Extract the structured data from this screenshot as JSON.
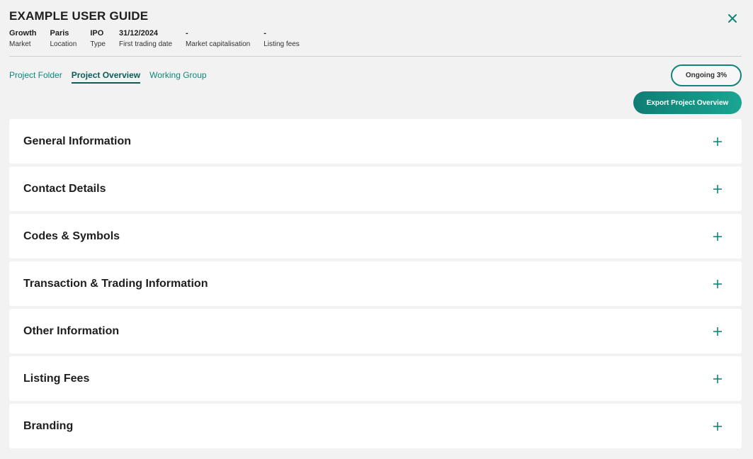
{
  "header": {
    "title": "EXAMPLE USER GUIDE",
    "close_icon": "close-icon"
  },
  "meta": [
    {
      "value": "Growth",
      "label": "Market"
    },
    {
      "value": "Paris",
      "label": "Location"
    },
    {
      "value": "IPO",
      "label": "Type"
    },
    {
      "value": "31/12/2024",
      "label": "First trading date"
    },
    {
      "value": "-",
      "label": "Market capitalisation"
    },
    {
      "value": "-",
      "label": "Listing fees"
    }
  ],
  "tabs": [
    {
      "label": "Project Folder",
      "active": false
    },
    {
      "label": "Project Overview",
      "active": true
    },
    {
      "label": "Working Group",
      "active": false
    }
  ],
  "status": {
    "label": "Ongoing 3%",
    "progress_percent": 3
  },
  "actions": {
    "export_label": "Export Project Overview"
  },
  "sections": [
    {
      "title": "General Information",
      "icon": "plus-icon"
    },
    {
      "title": "Contact Details",
      "icon": "plus-icon"
    },
    {
      "title": "Codes & Symbols",
      "icon": "plus-icon"
    },
    {
      "title": "Transaction & Trading Information",
      "icon": "plus-icon"
    },
    {
      "title": "Other Information",
      "icon": "plus-icon"
    },
    {
      "title": "Listing Fees",
      "icon": "plus-icon"
    },
    {
      "title": "Branding",
      "icon": "plus-icon"
    }
  ],
  "colors": {
    "accent": "#11857a",
    "accent_dark": "#0e5b55",
    "background": "#f2f2f2",
    "card": "#ffffff"
  }
}
